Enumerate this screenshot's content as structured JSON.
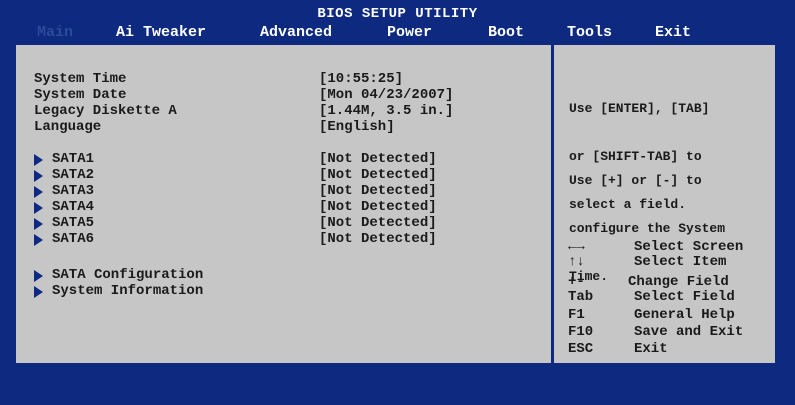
{
  "title": "BIOS SETUP UTILITY",
  "menu": [
    "Main",
    "Ai Tweaker",
    "Advanced",
    "Power",
    "Boot",
    "Tools",
    "Exit"
  ],
  "settings": [
    {
      "label": "System Time",
      "value": "[10:55:25]"
    },
    {
      "label": "System Date",
      "value": "[Mon 04/23/2007]"
    },
    {
      "label": "Legacy Diskette A",
      "value": "[1.44M, 3.5 in.]"
    },
    {
      "label": "Language",
      "value": "[English]"
    }
  ],
  "sata": [
    {
      "label": "SATA1",
      "value": "[Not Detected]"
    },
    {
      "label": "SATA2",
      "value": "[Not Detected]"
    },
    {
      "label": "SATA3",
      "value": "[Not Detected]"
    },
    {
      "label": "SATA4",
      "value": "[Not Detected]"
    },
    {
      "label": "SATA5",
      "value": "[Not Detected]"
    },
    {
      "label": "SATA6",
      "value": "[Not Detected]"
    }
  ],
  "submenus": [
    "SATA Configuration",
    "System Information"
  ],
  "help": {
    "lines1": [
      "Use [ENTER], [TAB]",
      "or [SHIFT-TAB] to",
      "select a field."
    ],
    "lines2": [
      "Use [+] or [-] to",
      "configure the System",
      "Time."
    ]
  },
  "keys": [
    {
      "key": "←→",
      "action": "Select Screen"
    },
    {
      "key": "↑↓",
      "action": "Select Item"
    },
    {
      "key": "+-",
      "action": "Change Field"
    },
    {
      "key": "Tab",
      "action": "Select Field"
    },
    {
      "key": "F1",
      "action": "General Help"
    },
    {
      "key": "F10",
      "action": "Save and Exit"
    },
    {
      "key": "ESC",
      "action": "Exit"
    }
  ],
  "colors": {
    "background": "#0d2a80",
    "panel": "#c6c6c6",
    "highlight": "#2a4a9a"
  }
}
